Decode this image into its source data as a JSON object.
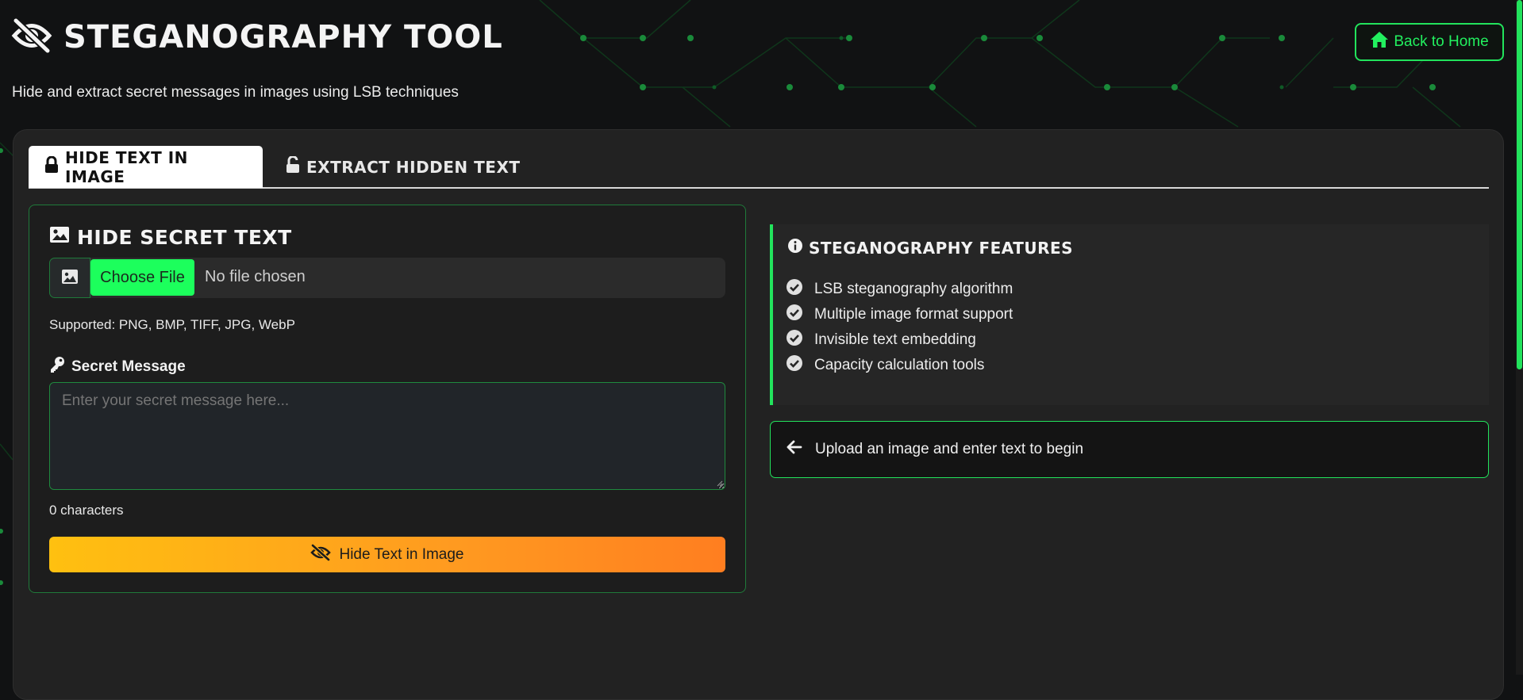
{
  "header": {
    "title": "STEGANOGRAPHY TOOL",
    "subtitle": "Hide and extract secret messages in images using LSB techniques",
    "home_button_label": "Back to Home"
  },
  "tabs": [
    {
      "label": "HIDE TEXT IN IMAGE",
      "icon": "lock-icon",
      "active": true
    },
    {
      "label": "EXTRACT HIDDEN TEXT",
      "icon": "unlock-icon",
      "active": false
    }
  ],
  "hide_form": {
    "title": "HIDE SECRET TEXT",
    "file": {
      "button_label": "Choose File",
      "status": "No file chosen"
    },
    "supported_formats": "Supported: PNG, BMP, TIFF, JPG, WebP",
    "message_label": "Secret Message",
    "message_placeholder": "Enter your secret message here...",
    "message_value": "",
    "char_count": "0 characters",
    "submit_label": "Hide Text in Image"
  },
  "features": {
    "title": "STEGANOGRAPHY FEATURES",
    "items": [
      "LSB steganography algorithm",
      "Multiple image format support",
      "Invisible text embedding",
      "Capacity calculation tools"
    ]
  },
  "info": {
    "message": "Upload an image and enter text to begin"
  },
  "colors": {
    "accent": "#22e35c",
    "background": "#111213",
    "panel": "#222222",
    "button_gradient_start": "#ffc010",
    "button_gradient_end": "#ff7e20"
  }
}
